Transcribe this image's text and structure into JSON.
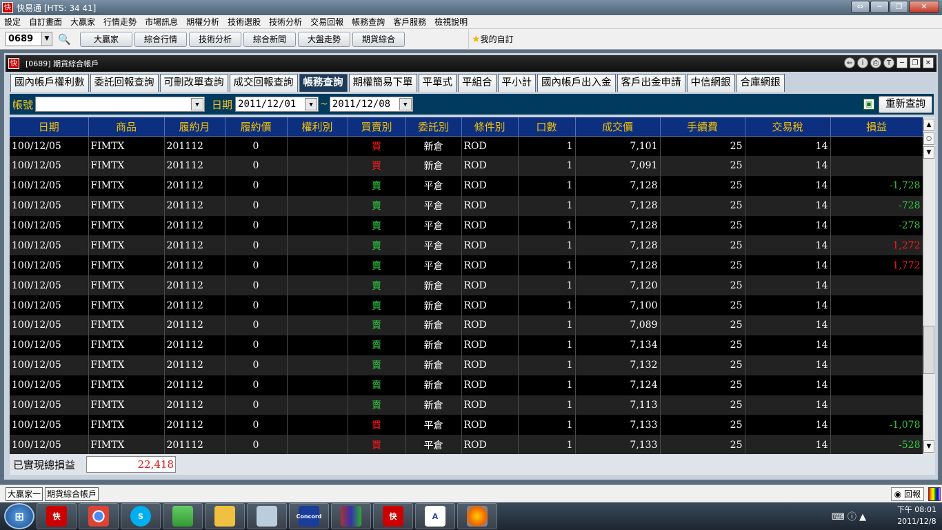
{
  "app": {
    "title": "快易通  [HTS: 34 41]",
    "icon_text": "快"
  },
  "menu": [
    "設定",
    "自訂畫面",
    "大贏家",
    "行情走勢",
    "市場訊息",
    "期權分析",
    "技術選股",
    "技術分析",
    "交易回報",
    "帳務查詢",
    "客戶服務",
    "檢視說明"
  ],
  "toolbar": {
    "stock_code": "0689",
    "buttons": [
      "大贏家",
      "綜合行情",
      "技術分析",
      "綜合新聞",
      "大盤走勢",
      "期貨綜合"
    ],
    "my_stocks": "我的自訂"
  },
  "subwindow": {
    "title": "[0689] 期貨綜合帳戶"
  },
  "tabs": [
    "國內帳戶權利數",
    "委託回報查詢",
    "可刪改單查詢",
    "成交回報查詢",
    "帳務查詢",
    "期權簡易下單",
    "平單式",
    "平組合",
    "平小計",
    "國內帳戶出入金",
    "客戶出金申請",
    "中信網銀",
    "合庫網銀"
  ],
  "active_tab": 4,
  "filter": {
    "account_label": "帳號",
    "account_value": "",
    "date_label": "日期",
    "date_from": "2011/12/01",
    "tilde": "~",
    "date_to": "2011/12/08",
    "requery_label": "重新查詢"
  },
  "table": {
    "columns": [
      "日期",
      "商品",
      "履約月",
      "履約價",
      "權利別",
      "買賣別",
      "委託別",
      "條件別",
      "口數",
      "成交價",
      "手續費",
      "交易稅",
      "損益"
    ],
    "rows": [
      [
        "100/12/05",
        "FIMTX",
        "201112",
        "0",
        "",
        "買",
        "新倉",
        "ROD",
        "1",
        "7,101",
        "25",
        "14",
        ""
      ],
      [
        "100/12/05",
        "FIMTX",
        "201112",
        "0",
        "",
        "買",
        "新倉",
        "ROD",
        "1",
        "7,091",
        "25",
        "14",
        ""
      ],
      [
        "100/12/05",
        "FIMTX",
        "201112",
        "0",
        "",
        "賣",
        "平倉",
        "ROD",
        "1",
        "7,128",
        "25",
        "14",
        "-1,728"
      ],
      [
        "100/12/05",
        "FIMTX",
        "201112",
        "0",
        "",
        "賣",
        "平倉",
        "ROD",
        "1",
        "7,128",
        "25",
        "14",
        "-728"
      ],
      [
        "100/12/05",
        "FIMTX",
        "201112",
        "0",
        "",
        "賣",
        "平倉",
        "ROD",
        "1",
        "7,128",
        "25",
        "14",
        "-278"
      ],
      [
        "100/12/05",
        "FIMTX",
        "201112",
        "0",
        "",
        "賣",
        "平倉",
        "ROD",
        "1",
        "7,128",
        "25",
        "14",
        "1,272"
      ],
      [
        "100/12/05",
        "FIMTX",
        "201112",
        "0",
        "",
        "賣",
        "平倉",
        "ROD",
        "1",
        "7,128",
        "25",
        "14",
        "1,772"
      ],
      [
        "100/12/05",
        "FIMTX",
        "201112",
        "0",
        "",
        "賣",
        "新倉",
        "ROD",
        "1",
        "7,120",
        "25",
        "14",
        ""
      ],
      [
        "100/12/05",
        "FIMTX",
        "201112",
        "0",
        "",
        "賣",
        "新倉",
        "ROD",
        "1",
        "7,100",
        "25",
        "14",
        ""
      ],
      [
        "100/12/05",
        "FIMTX",
        "201112",
        "0",
        "",
        "賣",
        "新倉",
        "ROD",
        "1",
        "7,089",
        "25",
        "14",
        ""
      ],
      [
        "100/12/05",
        "FIMTX",
        "201112",
        "0",
        "",
        "賣",
        "新倉",
        "ROD",
        "1",
        "7,134",
        "25",
        "14",
        ""
      ],
      [
        "100/12/05",
        "FIMTX",
        "201112",
        "0",
        "",
        "賣",
        "新倉",
        "ROD",
        "1",
        "7,132",
        "25",
        "14",
        ""
      ],
      [
        "100/12/05",
        "FIMTX",
        "201112",
        "0",
        "",
        "賣",
        "新倉",
        "ROD",
        "1",
        "7,124",
        "25",
        "14",
        ""
      ],
      [
        "100/12/05",
        "FIMTX",
        "201112",
        "0",
        "",
        "賣",
        "新倉",
        "ROD",
        "1",
        "7,113",
        "25",
        "14",
        ""
      ],
      [
        "100/12/05",
        "FIMTX",
        "201112",
        "0",
        "",
        "買",
        "平倉",
        "ROD",
        "1",
        "7,133",
        "25",
        "14",
        "-1,078"
      ],
      [
        "100/12/05",
        "FIMTX",
        "201112",
        "0",
        "",
        "買",
        "平倉",
        "ROD",
        "1",
        "7,133",
        "25",
        "14",
        "-528"
      ]
    ]
  },
  "footer": {
    "realized_label": "已實現總損益",
    "realized_value": "22,418"
  },
  "statusbar": {
    "tabs": [
      "大贏家一",
      "期貨綜合帳戶"
    ],
    "report": "回報"
  },
  "taskbar": {
    "apps": [
      "快易通",
      "chrome",
      "skype",
      "messenger",
      "explorer",
      "calculator",
      "Concord",
      "winrar",
      "快易通",
      "wordpad",
      "paint"
    ],
    "time": "下午 08:01",
    "date": "2011/12/8"
  },
  "colors": {
    "header_bg": "#0d2f80",
    "header_text": "#f2c200",
    "buy": "#ff1a1a",
    "sell": "#2ecc40",
    "filter_bg": "#003a5e"
  }
}
